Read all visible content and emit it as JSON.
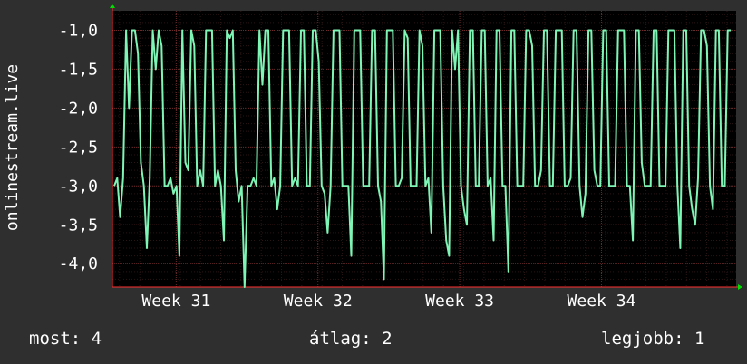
{
  "chart_data": {
    "type": "line",
    "ylabel": "onlinestream.live",
    "ylim": [
      -4.3,
      -0.75
    ],
    "y_ticks": [
      "-1,0",
      "-1,5",
      "-2,0",
      "-2,5",
      "-3,0",
      "-3,5",
      "-4,0"
    ],
    "y_tick_values": [
      -1.0,
      -1.5,
      -2.0,
      -2.5,
      -3.0,
      -3.5,
      -4.0
    ],
    "x_ticks": [
      "Week 31",
      "Week 32",
      "Week 33",
      "Week 34"
    ],
    "x_tick_values": [
      31,
      32,
      33,
      34
    ],
    "xlim": [
      30.55,
      34.95
    ],
    "grid": true,
    "colors": {
      "background": "#2f2f2f",
      "plot": "#000000",
      "series": "#7ff5b5",
      "grid": "#6a2a2a",
      "axis": "#ff3030",
      "arrow": "#00e000"
    },
    "series": [
      {
        "values": [
          -3.0,
          -2.9,
          -3.4,
          -2.9,
          -1.0,
          -2.0,
          -1.0,
          -1.0,
          -1.3,
          -2.7,
          -3.0,
          -3.8,
          -2.9,
          -1.0,
          -1.5,
          -1.0,
          -1.2,
          -3.0,
          -3.0,
          -2.9,
          -3.1,
          -3.0,
          -3.9,
          -1.0,
          -2.7,
          -2.8,
          -1.0,
          -1.2,
          -3.0,
          -2.8,
          -3.0,
          -1.0,
          -1.0,
          -1.0,
          -3.0,
          -2.8,
          -3.0,
          -3.7,
          -1.0,
          -1.1,
          -1.0,
          -2.8,
          -3.2,
          -3.0,
          -4.3,
          -3.0,
          -3.0,
          -2.9,
          -3.0,
          -1.0,
          -1.7,
          -1.0,
          -1.0,
          -3.0,
          -2.9,
          -3.3,
          -3.0,
          -1.0,
          -1.0,
          -1.0,
          -3.0,
          -2.9,
          -3.0,
          -1.0,
          -1.0,
          -3.0,
          -3.0,
          -1.0,
          -1.0,
          -1.4,
          -3.0,
          -3.1,
          -3.6,
          -3.0,
          -1.0,
          -1.0,
          -1.0,
          -3.0,
          -3.0,
          -3.0,
          -3.9,
          -1.0,
          -1.0,
          -1.0,
          -3.0,
          -3.0,
          -3.0,
          -1.0,
          -1.0,
          -3.0,
          -3.2,
          -4.2,
          -1.0,
          -1.0,
          -1.0,
          -3.0,
          -3.0,
          -2.9,
          -1.0,
          -1.1,
          -3.0,
          -3.0,
          -3.0,
          -1.0,
          -1.2,
          -3.0,
          -2.9,
          -3.6,
          -1.0,
          -1.0,
          -1.0,
          -3.0,
          -3.7,
          -3.9,
          -1.0,
          -1.5,
          -1.0,
          -3.0,
          -3.3,
          -3.5,
          -1.0,
          -1.0,
          -3.0,
          -3.0,
          -1.0,
          -1.0,
          -3.0,
          -2.9,
          -3.7,
          -1.0,
          -1.0,
          -3.0,
          -3.0,
          -4.1,
          -1.0,
          -1.0,
          -3.0,
          -3.0,
          -3.0,
          -1.0,
          -1.0,
          -1.2,
          -3.0,
          -3.0,
          -2.8,
          -1.0,
          -1.0,
          -3.0,
          -3.0,
          -1.0,
          -1.0,
          -1.0,
          -3.0,
          -3.0,
          -2.9,
          -1.0,
          -1.0,
          -3.0,
          -3.4,
          -3.1,
          -1.0,
          -1.0,
          -2.8,
          -3.0,
          -3.0,
          -1.0,
          -1.0,
          -3.0,
          -3.0,
          -3.0,
          -1.0,
          -1.0,
          -1.0,
          -3.0,
          -3.0,
          -3.7,
          -1.0,
          -1.0,
          -2.7,
          -3.0,
          -3.0,
          -3.0,
          -1.0,
          -1.0,
          -3.0,
          -3.0,
          -3.0,
          -1.0,
          -1.0,
          -1.0,
          -3.0,
          -3.8,
          -1.0,
          -1.0,
          -3.0,
          -3.3,
          -3.5,
          -2.9,
          -1.0,
          -1.0,
          -1.2,
          -3.0,
          -3.3,
          -1.0,
          -1.0,
          -3.0,
          -3.0,
          -1.0,
          -1.0
        ]
      }
    ]
  },
  "footer": {
    "now": "most: 4",
    "avg": "átlag: 2",
    "best": "legjobb: 1"
  }
}
